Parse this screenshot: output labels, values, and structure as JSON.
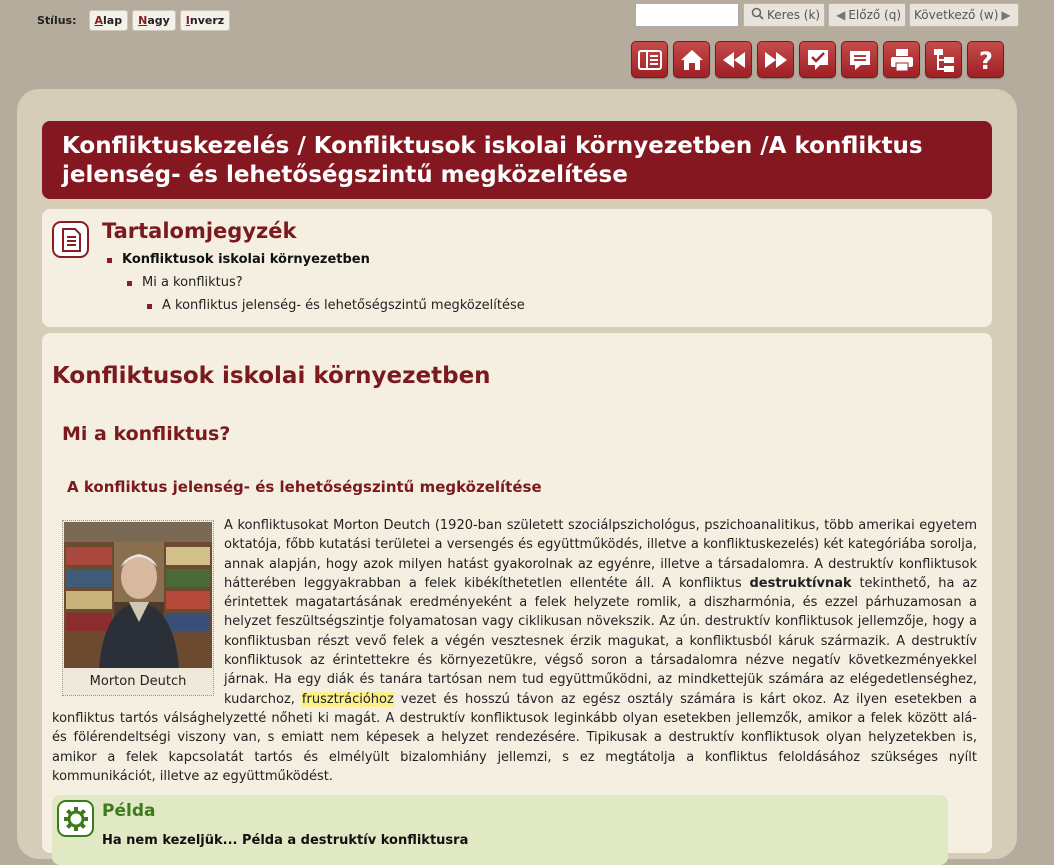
{
  "style_bar": {
    "label": "Stílus:",
    "buttons": [
      "Alap",
      "Nagy",
      "Inverz"
    ]
  },
  "search": {
    "value": "",
    "search_label": "Keres (k)",
    "prev_label": "Előző (q)",
    "next_label": "Következő (w)"
  },
  "toolbar_icons": [
    "toc-panel-icon",
    "home-icon",
    "rewind-icon",
    "fast-forward-icon",
    "checklist-icon",
    "comment-icon",
    "print-icon",
    "sitemap-icon",
    "help-icon"
  ],
  "title": "Konfliktuskezelés / Konfliktusok iskolai környezetben /A konfliktus jelenség- és lehetőségszintű megközelítése",
  "toc": {
    "title": "Tartalomjegyzék",
    "items": [
      {
        "label": "Konfliktusok iskolai környezetben",
        "level": 1
      },
      {
        "label": "Mi a konfliktus?",
        "level": 2
      },
      {
        "label": "A konfliktus jelenség- és lehetőségszintű megközelítése",
        "level": 3
      }
    ]
  },
  "content": {
    "h1": "Konfliktusok iskolai környezetben",
    "h2": "Mi a konfliktus?",
    "h3": "A konfliktus jelenség- és lehetőségszintű megközelítése",
    "figure_caption": "Morton Deutch",
    "paragraph": {
      "part1": "A konfliktusokat Morton Deutch (1920-ban született szociálpszichológus, pszichoanalitikus, több amerikai egyetem oktatója, főbb kutatási területei a versengés és együttműködés, illetve a konfliktuskezelés) két kategóriába sorolja, annak alapján, hogy azok milyen hatást gyakorolnak az egyénre, illetve a társadalomra. A destruktív konfliktusok hátterében leggyakrabban a felek kibékíthetetlen ellentéte áll. A konfliktus ",
      "bold": "destruktívnak",
      "part2": " tekinthető, ha az érintettek magatartásának eredményeként a felek helyzete romlik, a diszharmónia, és ezzel párhuzamosan a helyzet feszültségszintje folyamatosan vagy ciklikusan növekszik. Az ún. destruktív konfliktusok jellemzője, hogy a konfliktusban részt vevő felek a végén vesztesnek érzik magukat, a konfliktusból káruk származik. A destruktív konfliktusok az érintettekre és környezetükre, végső soron a társadalomra nézve negatív következményekkel járnak. Ha egy diák és tanára tartósan nem tud együttműködni, az mindkettejük számára az elégedetlenséghez, kudarchoz, ",
      "highlight": "frusztrációhoz",
      "part3": " vezet és hosszú távon az egész osztály számára is kárt okoz. Az ilyen esetekben a konfliktus tartós válsághelyzetté nőheti ki magát. A destruktív konfliktusok leginkább olyan esetekben jellemzők, amikor a felek között alá- és fölérendeltségi viszony van, s emiatt nem képesek a helyzet rendezésére. Tipikusak a destruktív konfliktusok olyan helyzetekben is, amikor a felek kapcsolatát tartós és elmélyült bizalomhiány jellemzi, s ez megtátolja a konfliktus feloldásához szükséges nyílt kommunikációt, illetve az együttműködést."
    }
  },
  "example": {
    "title": "Példa",
    "subtitle": "Ha nem kezeljük... Példa a destruktív konfliktusra"
  },
  "colors": {
    "accent": "#851720",
    "panel": "#d5cdb8",
    "content_bg": "#f4efe0",
    "example_bg": "#e1e8c4",
    "example_accent": "#3c7a1d"
  }
}
